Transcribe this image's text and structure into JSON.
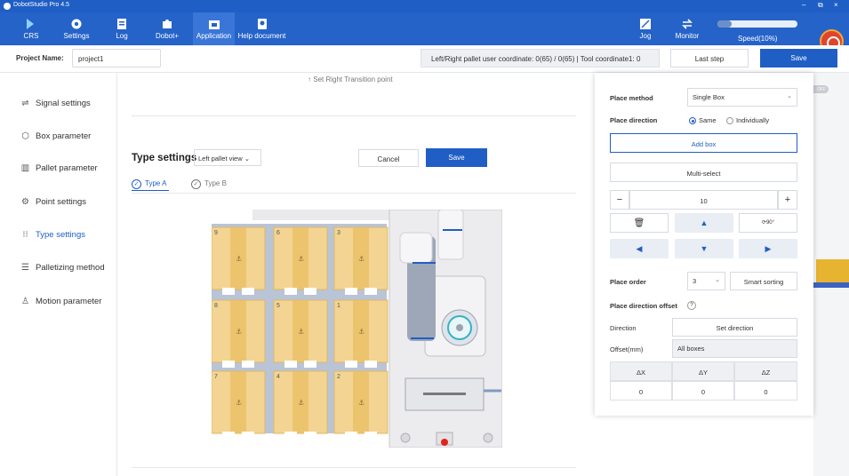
{
  "app": {
    "title": "DobotStudio Pro 4.5"
  },
  "toolbar": {
    "items": [
      {
        "label": "CRS"
      },
      {
        "label": "Settings"
      },
      {
        "label": "Log"
      },
      {
        "label": "Dobot+"
      },
      {
        "label": "Application"
      },
      {
        "label": "Help document"
      }
    ],
    "jog": "Jog",
    "monitor": "Monitor",
    "speed": "Speed(10%)",
    "speed_value": 0.1
  },
  "project": {
    "label": "Project Name:",
    "name": "project1",
    "coord_info": "Left/Right pallet user coordinate: 0(65) / 0(65) | Tool coordinate1: 0",
    "last_step": "Last step",
    "save": "Save"
  },
  "nav": [
    {
      "label": "Signal settings"
    },
    {
      "label": "Box parameter"
    },
    {
      "label": "Pallet parameter"
    },
    {
      "label": "Point settings"
    },
    {
      "label": "Type settings"
    },
    {
      "label": "Palletizing method"
    },
    {
      "label": "Motion parameter"
    }
  ],
  "main": {
    "hint": "Set Right Transition point",
    "type_title": "Type settings",
    "pallet_view": "Left pallet view",
    "cancel": "Cancel",
    "save": "Save",
    "tab_a": "Type A",
    "tab_b": "Type B",
    "box_numbers": [
      "9",
      "6",
      "3",
      "8",
      "5",
      "1",
      "7",
      "4",
      "2"
    ]
  },
  "panel": {
    "place_method_label": "Place method",
    "place_method_value": "Single Box",
    "place_direction_label": "Place direction",
    "same": "Same",
    "individually": "Individually",
    "add_box": "Add box",
    "multi_select": "Multi-select",
    "stepper_value": "10",
    "minus": "−",
    "plus": "+",
    "rotate": "90°",
    "place_order_label": "Place order",
    "place_order_value": "3",
    "smart_sorting": "Smart sorting",
    "offset_title": "Place direction offset",
    "help": "?",
    "direction_label": "Direction",
    "set_direction": "Set direction",
    "offset_label": "Offset(mm)",
    "all_boxes": "All boxes",
    "headers": [
      "ΔX",
      "ΔY",
      "ΔZ"
    ],
    "values": [
      "0",
      "0",
      "0"
    ]
  },
  "sim_toggle": "OFF"
}
